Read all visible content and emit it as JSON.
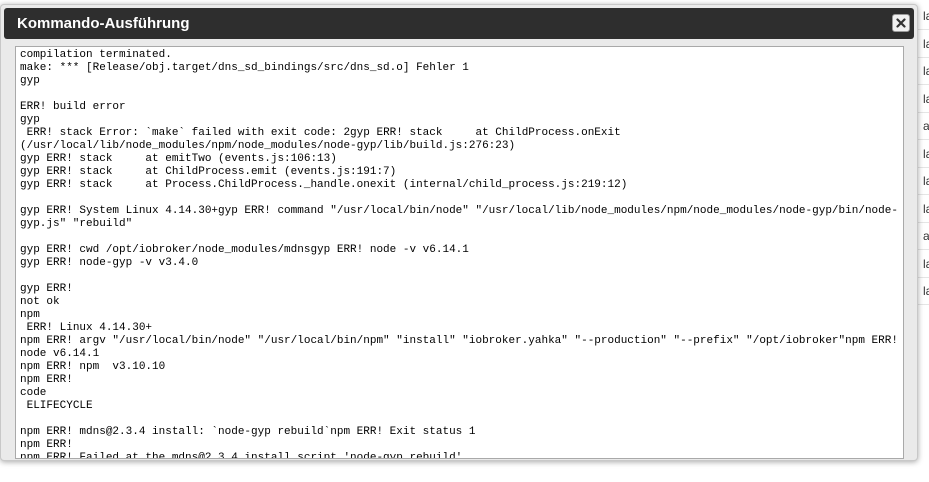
{
  "dialog": {
    "title": "Kommando-Ausführung",
    "close_icon": "close-icon",
    "log_text": "compilation terminated.\nmake: *** [Release/obj.target/dns_sd_bindings/src/dns_sd.o] Fehler 1\ngyp\n\nERR! build error\ngyp\n ERR! stack Error: `make` failed with exit code: 2gyp ERR! stack     at ChildProcess.onExit\n(/usr/local/lib/node_modules/npm/node_modules/node-gyp/lib/build.js:276:23)\ngyp ERR! stack     at emitTwo (events.js:106:13)\ngyp ERR! stack     at ChildProcess.emit (events.js:191:7)\ngyp ERR! stack     at Process.ChildProcess._handle.onexit (internal/child_process.js:219:12)\n\ngyp ERR! System Linux 4.14.30+gyp ERR! command \"/usr/local/bin/node\" \"/usr/local/lib/node_modules/npm/node_modules/node-gyp/bin/node-\ngyp.js\" \"rebuild\"\n\ngyp ERR! cwd /opt/iobroker/node_modules/mdnsgyp ERR! node -v v6.14.1\ngyp ERR! node-gyp -v v3.4.0\n\ngyp ERR!\nnot ok\nnpm\n ERR! Linux 4.14.30+\nnpm ERR! argv \"/usr/local/bin/node\" \"/usr/local/bin/npm\" \"install\" \"iobroker.yahka\" \"--production\" \"--prefix\" \"/opt/iobroker\"npm ERR!\nnode v6.14.1\nnpm ERR! npm  v3.10.10\nnpm ERR!\ncode\n ELIFECYCLE\n\nnpm ERR! mdns@2.3.4 install: `node-gyp rebuild`npm ERR! Exit status 1\nnpm ERR!\nnpm ERR! Failed at the mdns@2.3.4 install script 'node-gyp rebuild'."
  },
  "background": {
    "right_edge_letters": [
      "la",
      "la",
      "la",
      "la",
      "a",
      "la",
      "la",
      "la",
      "a",
      "la",
      "la"
    ]
  }
}
